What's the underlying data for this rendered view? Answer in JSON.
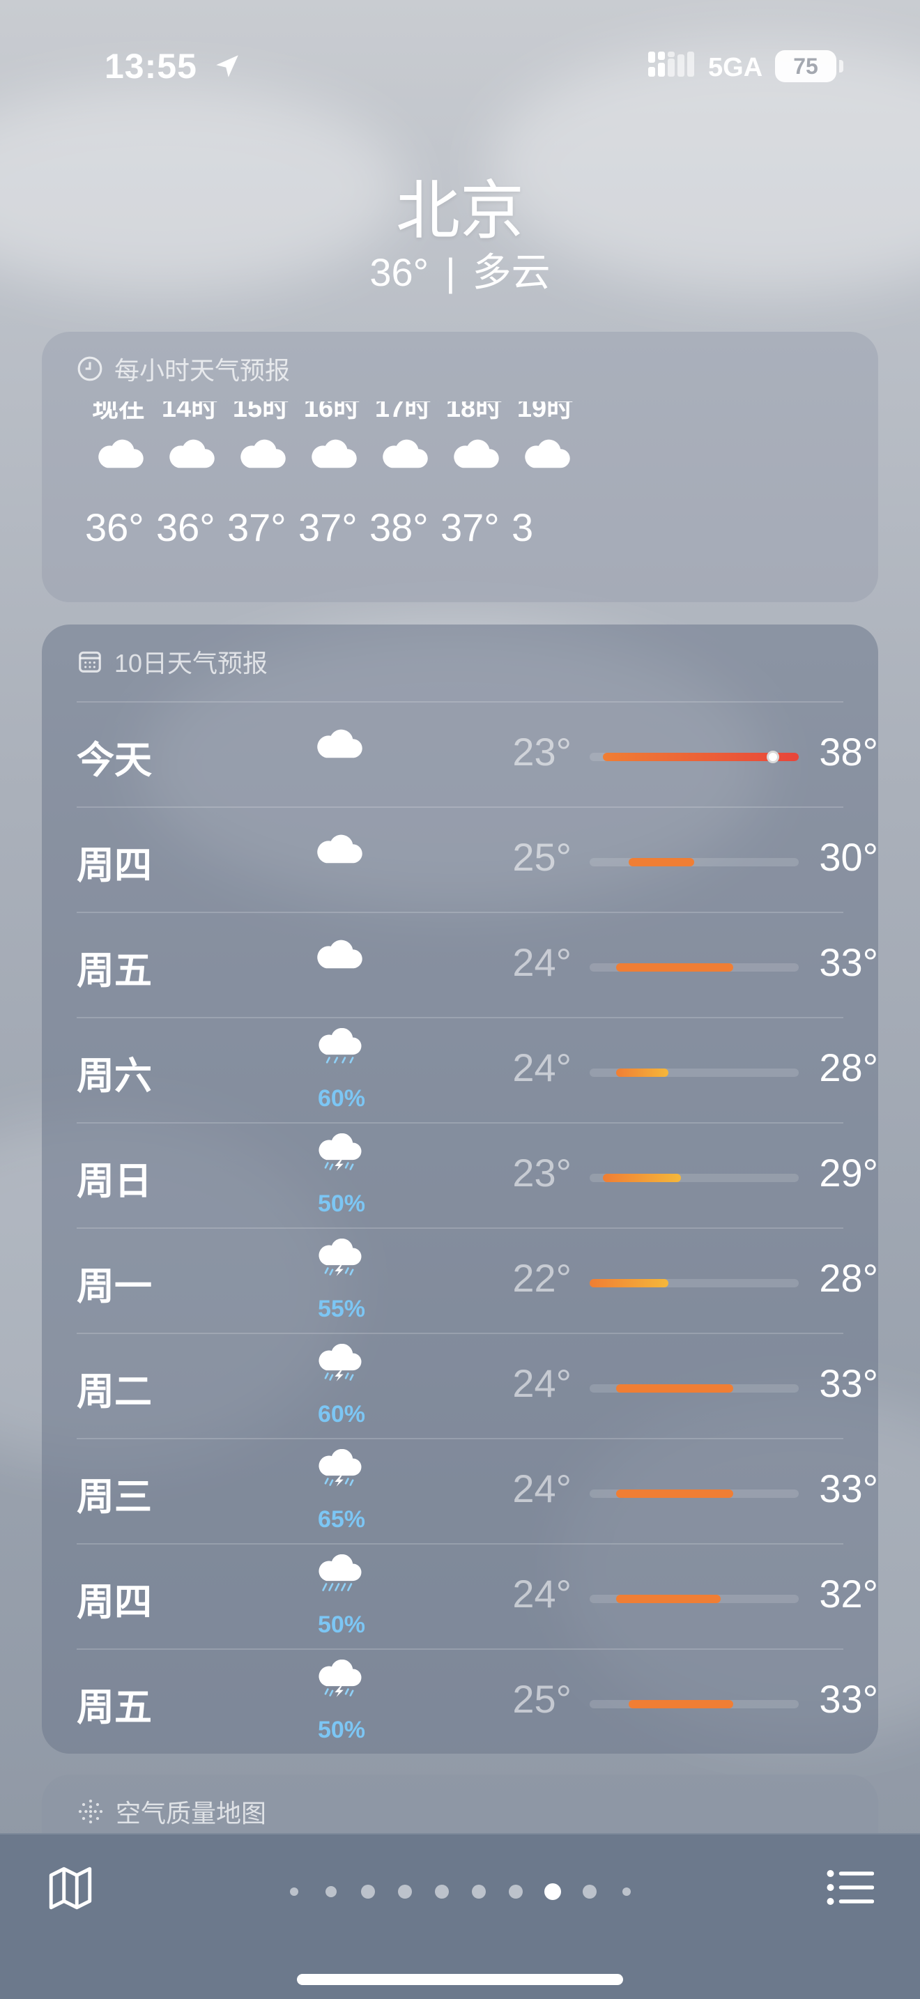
{
  "status_bar": {
    "time": "13:55",
    "network": "5GA",
    "battery": "75"
  },
  "header": {
    "city": "北京",
    "temperature": "36°",
    "separator": "|",
    "condition": "多云"
  },
  "hourly": {
    "title": "每小时天气预报",
    "items": [
      {
        "label": "现在",
        "icon": "cloud-icon",
        "temp": "36°"
      },
      {
        "label": "14时",
        "icon": "cloud-icon",
        "temp": "36°"
      },
      {
        "label": "15时",
        "icon": "cloud-icon",
        "temp": "37°"
      },
      {
        "label": "16时",
        "icon": "cloud-icon",
        "temp": "37°"
      },
      {
        "label": "17时",
        "icon": "cloud-icon",
        "temp": "38°"
      },
      {
        "label": "18时",
        "icon": "cloud-icon",
        "temp": "37°"
      },
      {
        "label": "19时",
        "icon": "cloud-icon",
        "temp": "3"
      }
    ]
  },
  "daily": {
    "title": "10日天气预报",
    "range_min": 22,
    "range_max": 38,
    "current_temp": 36,
    "days": [
      {
        "day": "今天",
        "icon": "cloud-icon",
        "precip": "",
        "low": "23°",
        "high": "38°",
        "lo": 23,
        "hi": 38,
        "current": true
      },
      {
        "day": "周四",
        "icon": "cloud-icon",
        "precip": "",
        "low": "25°",
        "high": "30°",
        "lo": 25,
        "hi": 30
      },
      {
        "day": "周五",
        "icon": "cloud-icon",
        "precip": "",
        "low": "24°",
        "high": "33°",
        "lo": 24,
        "hi": 33
      },
      {
        "day": "周六",
        "icon": "cloud-rain-icon",
        "precip": "60%",
        "low": "24°",
        "high": "28°",
        "lo": 24,
        "hi": 28
      },
      {
        "day": "周日",
        "icon": "cloud-bolt-rain-icon",
        "precip": "50%",
        "low": "23°",
        "high": "29°",
        "lo": 23,
        "hi": 29
      },
      {
        "day": "周一",
        "icon": "cloud-bolt-rain-icon",
        "precip": "55%",
        "low": "22°",
        "high": "28°",
        "lo": 22,
        "hi": 28
      },
      {
        "day": "周二",
        "icon": "cloud-bolt-rain-icon",
        "precip": "60%",
        "low": "24°",
        "high": "33°",
        "lo": 24,
        "hi": 33
      },
      {
        "day": "周三",
        "icon": "cloud-bolt-rain-icon",
        "precip": "65%",
        "low": "24°",
        "high": "33°",
        "lo": 24,
        "hi": 33
      },
      {
        "day": "周四",
        "icon": "cloud-heavy-rain-icon",
        "precip": "50%",
        "low": "24°",
        "high": "32°",
        "lo": 24,
        "hi": 32
      },
      {
        "day": "周五",
        "icon": "cloud-bolt-rain-icon",
        "precip": "50%",
        "low": "25°",
        "high": "33°",
        "lo": 25,
        "hi": 33
      }
    ]
  },
  "air_quality": {
    "title": "空气质量地图"
  },
  "bottom_bar": {
    "page_count": 10,
    "active_page": 8,
    "location_page": 1
  },
  "colors": {
    "precip": "#7cc6f4",
    "warm_start": "#f5b73a",
    "warm_end": "#f07e34",
    "hot": "#e8453a"
  }
}
